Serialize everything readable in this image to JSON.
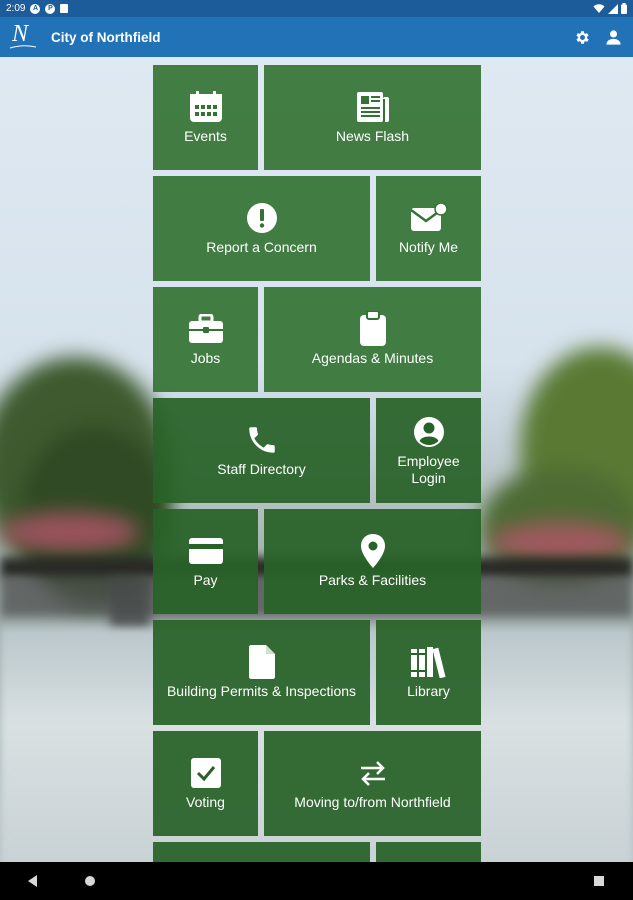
{
  "status_bar": {
    "time": "2:09",
    "icons": [
      "a-badge-icon",
      "p-badge-icon",
      "notification-square-icon",
      "wifi-icon",
      "signal-icon",
      "battery-icon"
    ]
  },
  "app_bar": {
    "title": "City of Northfield",
    "logo_letter": "N",
    "actions": [
      "settings-icon",
      "account-icon"
    ]
  },
  "theme": {
    "tile_green": "#347334",
    "app_bar_blue": "#2272b8",
    "status_blue": "#1c5c9a"
  },
  "tiles": [
    {
      "label": "Events",
      "icon": "calendar-icon"
    },
    {
      "label": "News Flash",
      "icon": "newspaper-icon"
    },
    {
      "label": "Report a Concern",
      "icon": "alert-icon"
    },
    {
      "label": "Notify Me",
      "icon": "mail-notify-icon"
    },
    {
      "label": "Jobs",
      "icon": "briefcase-icon"
    },
    {
      "label": "Agendas & Minutes",
      "icon": "clipboard-icon"
    },
    {
      "label": "Staff Directory",
      "icon": "phone-icon"
    },
    {
      "label": "Employee Login",
      "icon": "account-circle-icon"
    },
    {
      "label": "Pay",
      "icon": "credit-card-icon"
    },
    {
      "label": "Parks & Facilities",
      "icon": "map-pin-icon"
    },
    {
      "label": "Building Permits & Inspections",
      "icon": "document-icon"
    },
    {
      "label": "Library",
      "icon": "books-icon"
    },
    {
      "label": "Voting",
      "icon": "checkbox-icon"
    },
    {
      "label": "Moving to/from Northfield",
      "icon": "swap-arrows-icon"
    }
  ],
  "nav_bar": {
    "buttons": [
      "back-button",
      "home-button",
      "recents-button"
    ]
  }
}
